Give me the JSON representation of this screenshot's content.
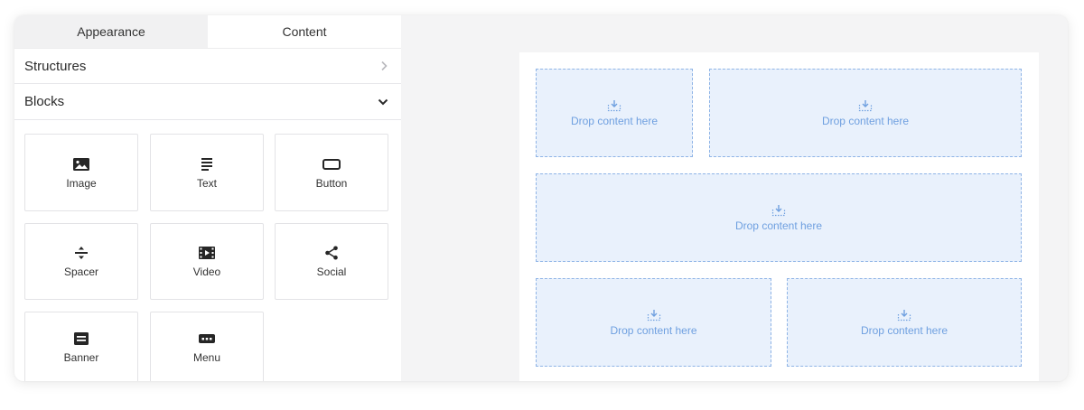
{
  "tabs": [
    {
      "label": "Appearance",
      "active": false
    },
    {
      "label": "Content",
      "active": true
    }
  ],
  "sections": {
    "structures": {
      "label": "Structures",
      "icon": "chevron-right-icon",
      "expanded": false
    },
    "blocks": {
      "label": "Blocks",
      "icon": "chevron-down-icon",
      "expanded": true
    }
  },
  "blocks": [
    {
      "label": "Image",
      "icon": "image-icon"
    },
    {
      "label": "Text",
      "icon": "text-icon"
    },
    {
      "label": "Button",
      "icon": "button-icon"
    },
    {
      "label": "Spacer",
      "icon": "spacer-icon"
    },
    {
      "label": "Video",
      "icon": "video-icon"
    },
    {
      "label": "Social",
      "icon": "share-icon"
    },
    {
      "label": "Banner",
      "icon": "banner-icon"
    },
    {
      "label": "Menu",
      "icon": "menu-icon"
    }
  ],
  "canvas": {
    "drop_text": "Drop content here",
    "drop_icon": "drop-download-icon",
    "accent": "#6fa0e0",
    "drop_fill": "#e9f1fc"
  }
}
